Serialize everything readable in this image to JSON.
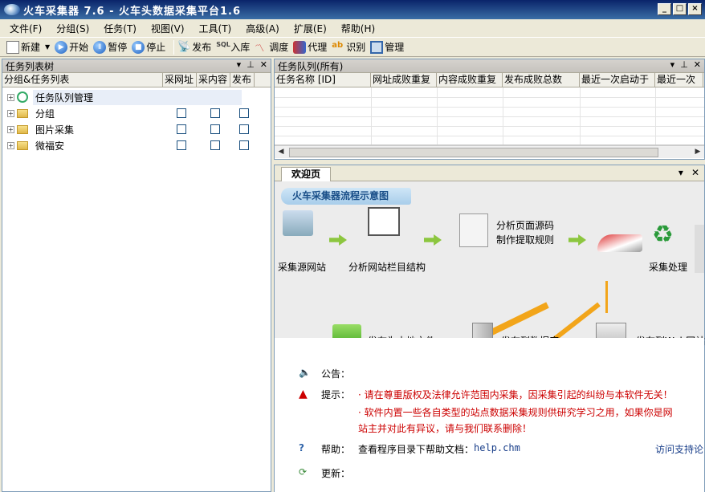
{
  "window": {
    "title": "火车采集器 7.6 - 火车头数据采集平台1.6"
  },
  "menu": [
    "文件(F)",
    "分组(S)",
    "任务(T)",
    "视图(V)",
    "工具(T)",
    "高级(A)",
    "扩展(E)",
    "帮助(H)"
  ],
  "toolbar": {
    "new": "新建",
    "start": "开始",
    "pause": "暂停",
    "stop": "停止",
    "publish": "发布",
    "import": "入库",
    "schedule": "调度",
    "proxy": "代理",
    "recognize": "识别",
    "manage": "管理"
  },
  "left_pane": {
    "title": "任务列表树",
    "columns": [
      "分组&任务列表",
      "采网址",
      "采内容",
      "发布"
    ],
    "items": [
      "任务队列管理",
      "分组",
      "图片采集",
      "微福安"
    ]
  },
  "queue_pane": {
    "title": "任务队列(所有)",
    "columns": [
      "任务名称 [ID]",
      "网址成败重复",
      "内容成败重复",
      "发布成败总数",
      "最近一次启动于",
      "最近一次"
    ]
  },
  "welcome": {
    "tab": "欢迎页",
    "flow_title": "火车采集器流程示意图",
    "nodes": {
      "source": "采集源网站",
      "analyze_site": "分析网站栏目结构",
      "analyze_code_1": "分析页面源码",
      "analyze_code_2": "制作提取规则",
      "process": "采集处理",
      "local": "发布为本地文件",
      "db": "发布到数据库",
      "web": "发布到Web网站"
    },
    "notice": {
      "announce_label": "公告：",
      "tip_label": "提示：",
      "tip_1": "· 请在尊重版权及法律允许范围内采集，因采集引起的纠纷与本软件无关！",
      "tip_2a": "· 软件内置一些各自类型的站点数据采集规则供研究学习之用，如果你是网",
      "tip_2b": "站主并对此有异议，请与我们联系删除！",
      "help_label": "帮助：",
      "help_text": "查看程序目录下帮助文档：",
      "help_file": "help.chm",
      "support_link": "访问支持论",
      "update_label": "更新："
    }
  }
}
